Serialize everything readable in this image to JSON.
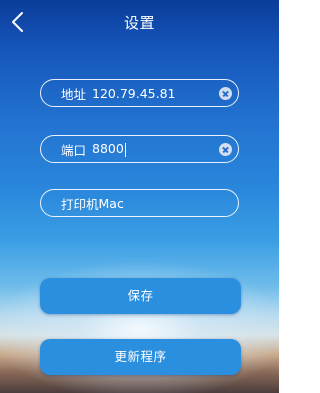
{
  "header": {
    "title": "设置",
    "back_icon": "chevron-left-icon"
  },
  "fields": {
    "address": {
      "label": "地址",
      "value": "120.79.45.81",
      "clear_icon": "clear-icon"
    },
    "port": {
      "label": "端口",
      "value": "8800",
      "clear_icon": "clear-icon"
    },
    "printer": {
      "label": "打印机",
      "value": "Mac"
    }
  },
  "buttons": {
    "save": "保存",
    "update": "更新程序"
  },
  "colors": {
    "accent": "#2b8fe0",
    "text": "#ffffff",
    "field_border": "#ffffff"
  }
}
